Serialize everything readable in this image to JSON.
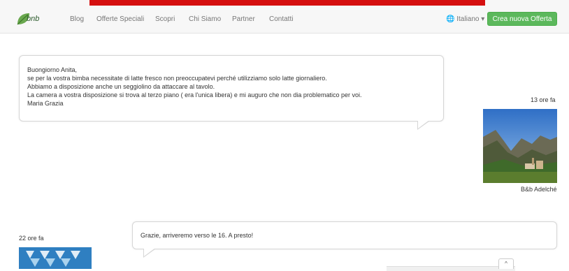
{
  "brand": {
    "logo_text": "bnb"
  },
  "nav": {
    "items": [
      "Blog",
      "Offerte Speciali",
      "Scopri",
      "Chi Siamo",
      "Partner",
      "Contatti"
    ],
    "language": "Italiano",
    "cta_label": "Crea nuova Offerta"
  },
  "messages": [
    {
      "lines": [
        "Buongiorno Anita,",
        "se per la vostra bimba necessitate di latte fresco non preoccupatevi perché utilizziamo solo latte giornaliero.",
        "Abbiamo a disposizione anche un seggiolino da attaccare al tavolo.",
        "La camera a vostra disposizione si trova al terzo piano ( era l'unica libera) e mi auguro che non dia problematico per voi.",
        "Maria Grazia"
      ],
      "time": "13 ore fa",
      "sender_name": "B&b Adelché"
    },
    {
      "text": "Grazie, arriveremo verso le 16. A presto!",
      "time": "22 ore fa"
    }
  ],
  "colors": {
    "accent_red": "#d50f0f",
    "cta_green": "#5cb85c",
    "bubble_border": "#d6d6d6"
  },
  "icons": {
    "scroll_up": "^"
  }
}
